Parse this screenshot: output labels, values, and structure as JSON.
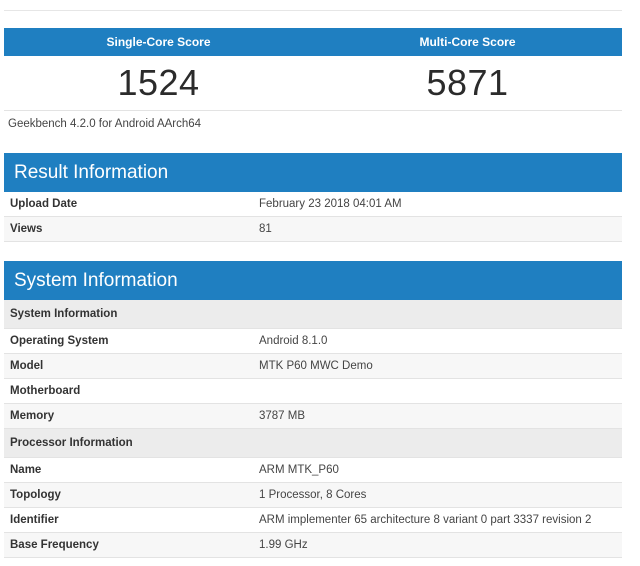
{
  "scores": {
    "single_label": "Single-Core Score",
    "multi_label": "Multi-Core Score",
    "single_value": "1524",
    "multi_value": "5871"
  },
  "version_text": "Geekbench 4.2.0 for Android AArch64",
  "result_info": {
    "title": "Result Information",
    "rows": [
      {
        "label": "Upload Date",
        "value": "February 23 2018 04:01 AM"
      },
      {
        "label": "Views",
        "value": "81"
      }
    ]
  },
  "system_info": {
    "title": "System Information",
    "subheads": [
      "System Information",
      "Processor Information"
    ],
    "system_rows": [
      {
        "label": "Operating System",
        "value": "Android 8.1.0"
      },
      {
        "label": "Model",
        "value": "MTK P60 MWC Demo"
      },
      {
        "label": "Motherboard",
        "value": ""
      },
      {
        "label": "Memory",
        "value": "3787 MB"
      }
    ],
    "processor_rows": [
      {
        "label": "Name",
        "value": "ARM MTK_P60"
      },
      {
        "label": "Topology",
        "value": "1 Processor, 8 Cores"
      },
      {
        "label": "Identifier",
        "value": "ARM implementer 65 architecture 8 variant 0 part 3337 revision 2"
      },
      {
        "label": "Base Frequency",
        "value": "1.99 GHz"
      }
    ]
  },
  "colors": {
    "header_blue": "#1f7fc1",
    "subhead_gray": "#ececec"
  }
}
